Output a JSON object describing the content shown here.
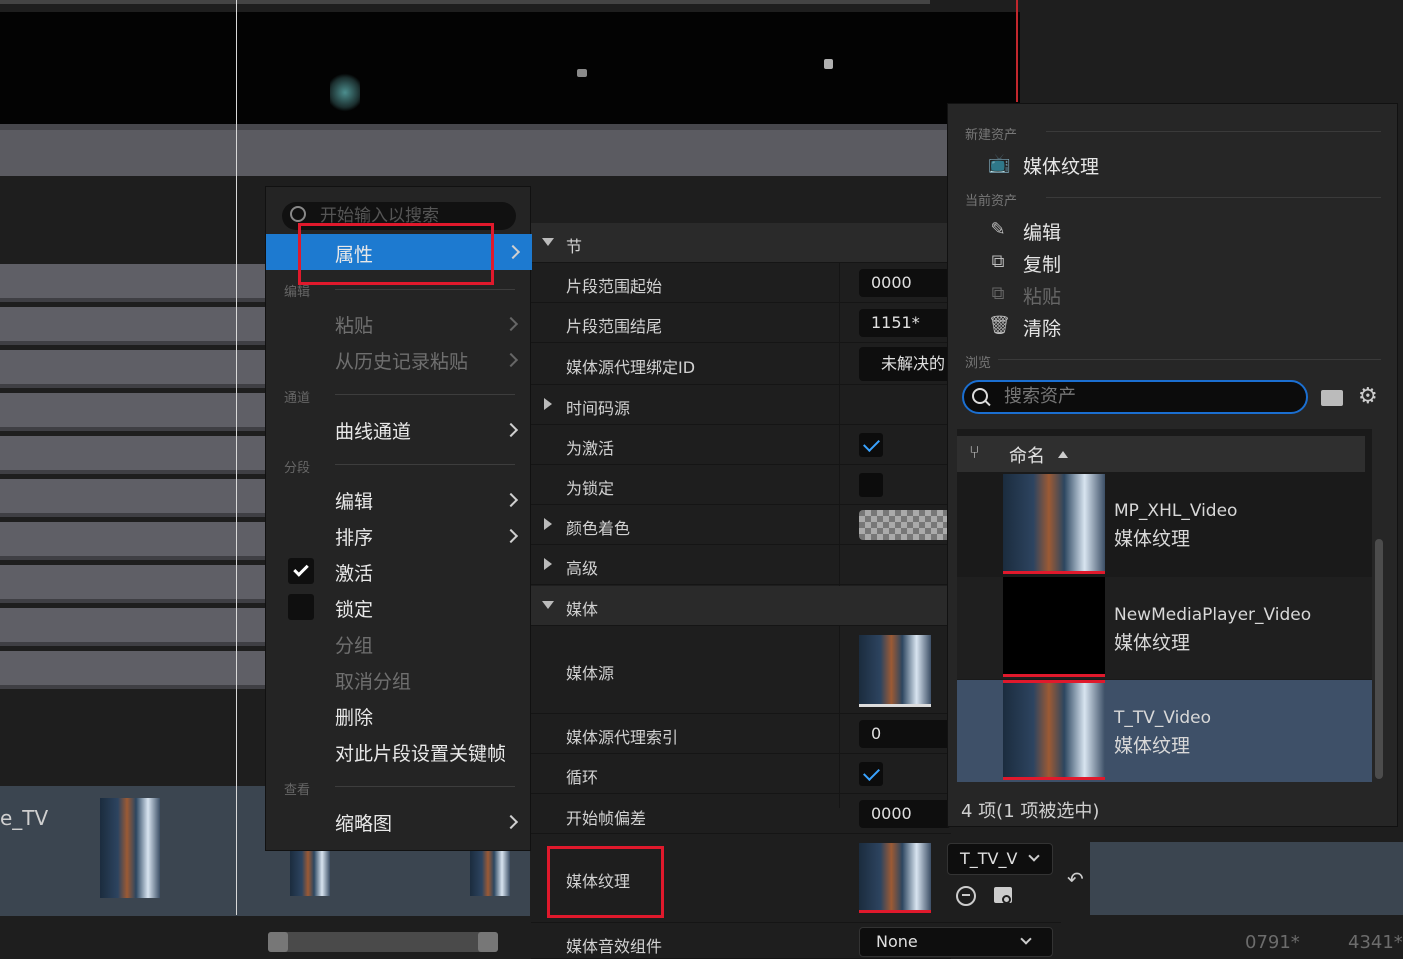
{
  "timeline": {
    "track_label": "e_TV",
    "frame_left": "0791*",
    "frame_right": "4341*"
  },
  "context_menu": {
    "search_placeholder": "开始输入以搜索",
    "selected": "属性",
    "sections": {
      "edit": "编辑",
      "channels": "通道",
      "section": "分段",
      "view": "查看"
    },
    "items": {
      "paste": "粘贴",
      "paste_history": "从历史记录粘贴",
      "curve_channels": "曲线通道",
      "edit": "编辑",
      "sort": "排序",
      "active": "激活",
      "locked": "锁定",
      "group": "分组",
      "ungroup": "取消分组",
      "delete": "删除",
      "key_section": "对此片段设置关键帧",
      "thumbnail": "缩略图"
    },
    "active_checked": true,
    "locked_checked": false
  },
  "details": {
    "section_header": "节",
    "range_start_label": "片段范围起始",
    "range_start_value": "0000",
    "range_end_label": "片段范围结尾",
    "range_end_value": "1151*",
    "proxy_binding_label": "媒体源代理绑定ID",
    "proxy_binding_value": "未解决的",
    "timecode_label": "时间码源",
    "is_active_label": "为激活",
    "is_active": true,
    "is_locked_label": "为锁定",
    "is_locked": false,
    "color_tint_label": "颜色着色",
    "advanced_label": "高级",
    "media_header": "媒体",
    "media_source_label": "媒体源",
    "proxy_index_label": "媒体源代理索引",
    "proxy_index_value": "0",
    "loop_label": "循环",
    "loop": true,
    "start_offset_label": "开始帧偏差",
    "start_offset_value": "0000",
    "media_texture_label": "媒体纹理",
    "media_texture_value": "T_TV_V",
    "audio_label": "媒体音效组件",
    "audio_value": "None"
  },
  "picker": {
    "new_asset_header": "新建资产",
    "new_media_texture": "媒体纹理",
    "current_asset_header": "当前资产",
    "edit": "编辑",
    "copy": "复制",
    "paste": "粘贴",
    "clear": "清除",
    "browse_header": "浏览",
    "search_placeholder": "搜索资产",
    "column_name": "命名",
    "assets": [
      {
        "name": "MP_XHL_Video",
        "type": "媒体纹理",
        "selected": false
      },
      {
        "name": "NewMediaPlayer_Video",
        "type": "媒体纹理",
        "selected": false
      },
      {
        "name": "T_TV_Video",
        "type": "媒体纹理",
        "selected": true
      }
    ],
    "count": "4 项(1 项被选中)"
  },
  "colors": {
    "accent": "#1d7ad0",
    "highlight_box": "#e0192c",
    "selected_row": "#3e5068"
  }
}
